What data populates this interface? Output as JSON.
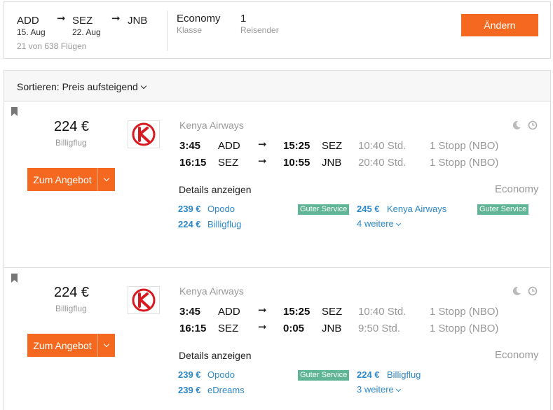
{
  "search": {
    "origin": "ADD",
    "origin_date": "15. Aug",
    "stop": "SEZ",
    "stop_date": "22. Aug",
    "destination": "JNB",
    "count_text": "21 von 638 Flügen",
    "cabin_value": "Economy",
    "cabin_label": "Klasse",
    "travelers_value": "1",
    "travelers_label": "Reisender",
    "change_label": "Ändern"
  },
  "sort": {
    "label": "Sortieren: Preis aufsteigend"
  },
  "results": [
    {
      "price": "224 €",
      "provider": "Billigflug",
      "deal_label": "Zum Angebot",
      "airline": "Kenya Airways",
      "legs": [
        {
          "dep_time": "3:45",
          "dep_ap": "ADD",
          "arr_time": "15:25",
          "arr_ap": "SEZ",
          "duration": "10:40 Std.",
          "stops": "1 Stopp (NBO)"
        },
        {
          "dep_time": "16:15",
          "dep_ap": "SEZ",
          "arr_time": "10:55",
          "arr_ap": "JNB",
          "duration": "20:40 Std.",
          "stops": "1 Stopp (NBO)"
        }
      ],
      "details_label": "Details anzeigen",
      "cabin": "Economy",
      "offers_left": [
        {
          "price": "239 €",
          "name": "Opodo",
          "badge": "Guter Service"
        },
        {
          "price": "224 €",
          "name": "Billigflug",
          "badge": ""
        }
      ],
      "offers_right": [
        {
          "price": "245 €",
          "name": "Kenya Airways",
          "badge": "Guter Service"
        }
      ],
      "more_label": "4 weitere"
    },
    {
      "price": "224 €",
      "provider": "Billigflug",
      "deal_label": "Zum Angebot",
      "airline": "Kenya Airways",
      "legs": [
        {
          "dep_time": "3:45",
          "dep_ap": "ADD",
          "arr_time": "15:25",
          "arr_ap": "SEZ",
          "duration": "10:40 Std.",
          "stops": "1 Stopp (NBO)"
        },
        {
          "dep_time": "16:15",
          "dep_ap": "SEZ",
          "arr_time": "0:05",
          "arr_ap": "JNB",
          "duration": "9:50 Std.",
          "stops": "1 Stopp (NBO)"
        }
      ],
      "details_label": "Details anzeigen",
      "cabin": "Economy",
      "offers_left": [
        {
          "price": "239 €",
          "name": "Opodo",
          "badge": "Guter Service"
        },
        {
          "price": "239 €",
          "name": "eDreams",
          "badge": ""
        }
      ],
      "offers_right": [
        {
          "price": "224 €",
          "name": "Billigflug",
          "badge": ""
        }
      ],
      "more_label": "3 weitere"
    }
  ],
  "colors": {
    "accent": "#f4691f",
    "link": "#2d88c9",
    "badge": "#5fb595"
  },
  "icons": [
    "bookmark-icon",
    "moon-icon",
    "clock-icon",
    "kenya-airways-logo",
    "arrow-right-icon",
    "chevron-down-icon"
  ]
}
